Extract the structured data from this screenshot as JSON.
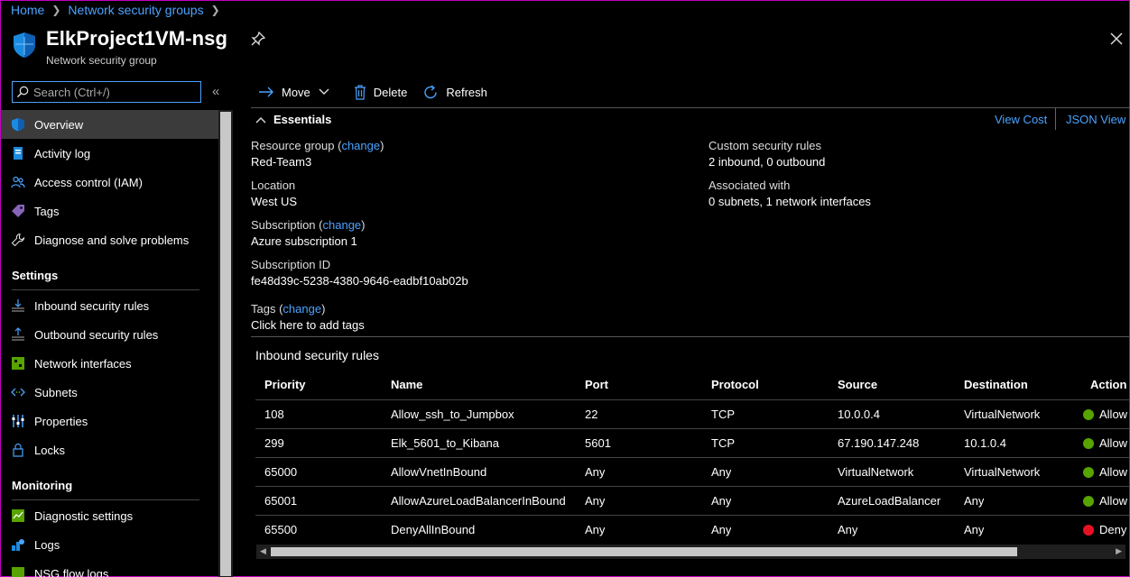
{
  "breadcrumb": {
    "home": "Home",
    "section": "Network security groups"
  },
  "header": {
    "title": "ElkProject1VM-nsg",
    "subtitle": "Network security group",
    "icon": "shield-icon"
  },
  "search": {
    "placeholder": "Search (Ctrl+/)"
  },
  "sidebar": {
    "items": [
      {
        "label": "Overview",
        "icon": "shield-icon",
        "active": true
      },
      {
        "label": "Activity log",
        "icon": "activity-log-icon"
      },
      {
        "label": "Access control (IAM)",
        "icon": "people-icon"
      },
      {
        "label": "Tags",
        "icon": "tag-icon"
      },
      {
        "label": "Diagnose and solve problems",
        "icon": "wrench-icon"
      }
    ],
    "settings_heading": "Settings",
    "settings_items": [
      {
        "label": "Inbound security rules",
        "icon": "inbound-rules-icon"
      },
      {
        "label": "Outbound security rules",
        "icon": "outbound-rules-icon"
      },
      {
        "label": "Network interfaces",
        "icon": "network-interface-icon"
      },
      {
        "label": "Subnets",
        "icon": "subnet-icon"
      },
      {
        "label": "Properties",
        "icon": "properties-icon"
      },
      {
        "label": "Locks",
        "icon": "lock-icon"
      }
    ],
    "monitoring_heading": "Monitoring",
    "monitoring_items": [
      {
        "label": "Diagnostic settings",
        "icon": "diagnostic-icon"
      },
      {
        "label": "Logs",
        "icon": "logs-icon"
      },
      {
        "label": "NSG flow logs",
        "icon": "flow-logs-icon"
      }
    ]
  },
  "toolbar": {
    "move": "Move",
    "delete": "Delete",
    "refresh": "Refresh"
  },
  "essentials": {
    "label": "Essentials",
    "view_cost": "View Cost",
    "json_view": "JSON View",
    "resource_group_label": "Resource group",
    "change": "change",
    "resource_group": "Red-Team3",
    "location_label": "Location",
    "location": "West US",
    "subscription_label": "Subscription",
    "subscription": "Azure subscription 1",
    "subscription_id_label": "Subscription ID",
    "subscription_id": "fe48d39c-5238-4380-9646-eadbf10ab02b",
    "tags_label": "Tags",
    "tags_link": "Click here to add tags",
    "custom_rules_label": "Custom security rules",
    "custom_rules": "2 inbound, 0 outbound",
    "associated_label": "Associated with",
    "associated": "0 subnets, 1 network interfaces"
  },
  "inbound": {
    "title": "Inbound security rules",
    "columns": [
      "Priority",
      "Name",
      "Port",
      "Protocol",
      "Source",
      "Destination",
      "Action"
    ],
    "rows": [
      {
        "priority": "108",
        "name": "Allow_ssh_to_Jumpbox",
        "port": "22",
        "protocol": "TCP",
        "source": "10.0.0.4",
        "destination": "VirtualNetwork",
        "action": "Allow",
        "status": "allow"
      },
      {
        "priority": "299",
        "name": "Elk_5601_to_Kibana",
        "port": "5601",
        "protocol": "TCP",
        "source": "67.190.147.248",
        "destination": "10.1.0.4",
        "action": "Allow",
        "status": "allow"
      },
      {
        "priority": "65000",
        "name": "AllowVnetInBound",
        "port": "Any",
        "protocol": "Any",
        "source": "VirtualNetwork",
        "destination": "VirtualNetwork",
        "action": "Allow",
        "status": "allow"
      },
      {
        "priority": "65001",
        "name": "AllowAzureLoadBalancerInBound",
        "port": "Any",
        "protocol": "Any",
        "source": "AzureLoadBalancer",
        "destination": "Any",
        "action": "Allow",
        "status": "allow"
      },
      {
        "priority": "65500",
        "name": "DenyAllInBound",
        "port": "Any",
        "protocol": "Any",
        "source": "Any",
        "destination": "Any",
        "action": "Deny",
        "status": "deny"
      }
    ]
  },
  "colors": {
    "accent": "#4aa3ff",
    "allow": "#57a300",
    "deny": "#e81123",
    "azure_blue": "#0078d4"
  }
}
